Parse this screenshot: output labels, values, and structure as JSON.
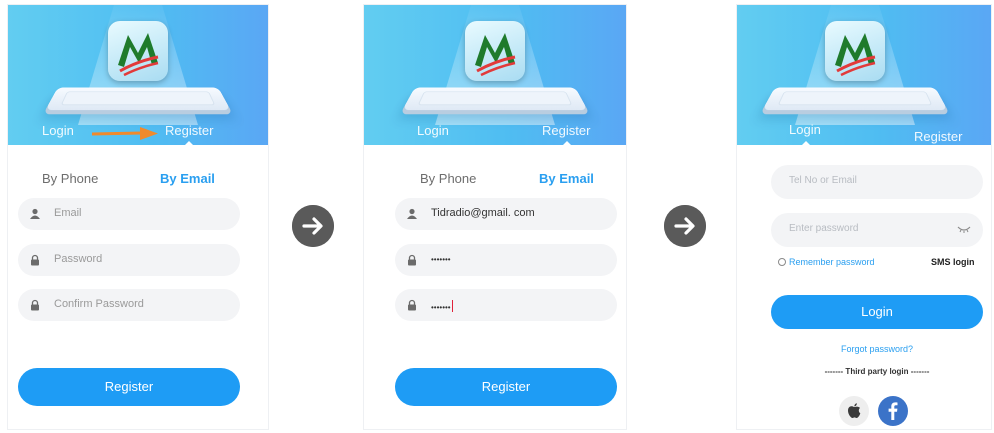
{
  "panels": {
    "register_empty": {
      "tabs": {
        "login": "Login",
        "register": "Register"
      },
      "segments": {
        "phone": "By Phone",
        "email": "By Email"
      },
      "fields": {
        "email": "Email",
        "password": "Password",
        "confirm": "Confirm Password"
      },
      "button": "Register"
    },
    "register_filled": {
      "tabs": {
        "login": "Login",
        "register": "Register"
      },
      "segments": {
        "phone": "By Phone",
        "email": "By Email"
      },
      "fields": {
        "email": "Tidradio@gmail. com",
        "password": "•••••••",
        "confirm": "•••••••"
      },
      "button": "Register"
    },
    "login": {
      "tabs": {
        "login": "Login",
        "register": "Register"
      },
      "fields": {
        "account": "Tel No or Email",
        "password": "Enter password"
      },
      "remember": "Remember password",
      "sms": "SMS login",
      "button": "Login",
      "forgot": "Forgot password?",
      "third_party": "------- Third party login -------"
    }
  },
  "icons": {
    "arrow": "arrow-right-icon",
    "user": "user-icon",
    "lock": "lock-icon",
    "eye": "eye-closed-icon",
    "apple": "apple-icon",
    "facebook": "facebook-icon"
  },
  "colors": {
    "accent": "#1e9cf5",
    "banner": "#52c0f2",
    "pointer": "#f08a2c",
    "step_arrow": "#5a5a5a",
    "facebook": "#3b73c8"
  }
}
